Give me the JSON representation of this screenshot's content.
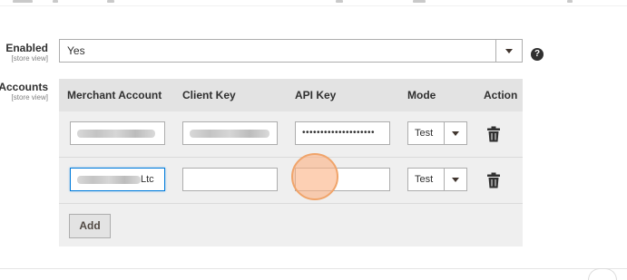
{
  "enabled": {
    "label": "Enabled",
    "scope": "[store view]",
    "value": "Yes",
    "help_glyph": "?"
  },
  "accounts": {
    "label": "Accounts",
    "scope": "[store view]",
    "columns": [
      "Merchant Account",
      "Client Key",
      "API Key",
      "Mode",
      "Action"
    ],
    "rows": [
      {
        "merchant_account": "",
        "client_key": "",
        "api_key": "••••••••••••••••••••",
        "mode": "Test"
      },
      {
        "merchant_account_suffix": "Ltc",
        "client_key": "",
        "api_key": "",
        "mode": "Test"
      }
    ],
    "add_button": "Add"
  },
  "icons": {
    "dropdown": "chevron-down-icon",
    "help": "help-icon",
    "delete": "trash-icon"
  },
  "colors": {
    "focus_border": "#007bdb",
    "click_indicator": "#fcb082"
  }
}
